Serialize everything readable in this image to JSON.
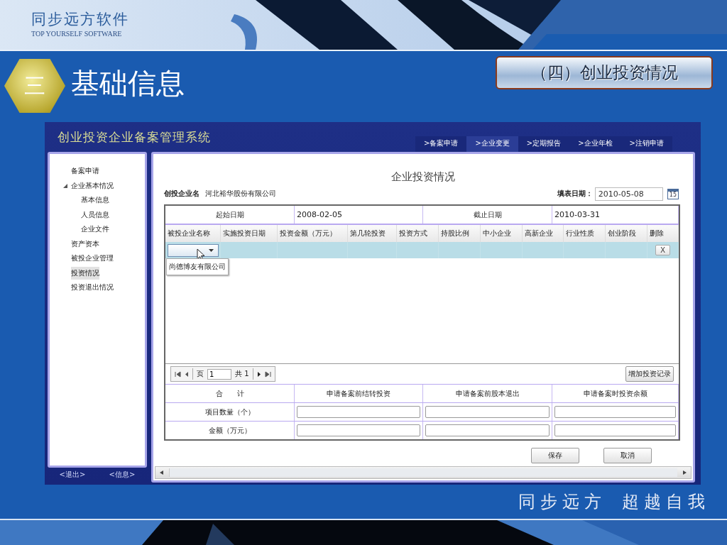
{
  "brand": {
    "name": "同步远方软件",
    "tagline": "TOP YOURSELF SOFTWARE"
  },
  "section": {
    "number": "三",
    "title": "基础信息",
    "subtitle": "（四）创业投资情况"
  },
  "app": {
    "title": "创业投资企业备案管理系统",
    "nav": [
      {
        "label": ">备案申请",
        "selected": false
      },
      {
        "label": ">企业变更",
        "selected": true
      },
      {
        "label": ">定期报告",
        "selected": false
      },
      {
        "label": ">企业年检",
        "selected": false
      },
      {
        "label": ">注销申请",
        "selected": false
      }
    ],
    "sidebar": {
      "items": [
        {
          "label": "备案申请",
          "selected": false
        },
        {
          "label": "企业基本情况",
          "selected": false,
          "expanded": true,
          "children": [
            {
              "label": "基本信息",
              "selected": false
            },
            {
              "label": "人员信息",
              "selected": false
            },
            {
              "label": "企业文件",
              "selected": false
            }
          ]
        },
        {
          "label": "资产资本",
          "selected": false
        },
        {
          "label": "被投企业管理",
          "selected": false
        },
        {
          "label": "投资情况",
          "selected": true
        },
        {
          "label": "投资退出情况",
          "selected": false
        }
      ],
      "footer": [
        "<退出>",
        "<信息>"
      ]
    },
    "form": {
      "heading": "企业投资情况",
      "company_label": "创投企业名",
      "company": "河北裕华股份有限公司",
      "date_label": "填表日期：",
      "date": "2010-05-08",
      "calendar_day": "15",
      "period": {
        "start_label": "起始日期",
        "start": "2008-02-05",
        "end_label": "截止日期",
        "end": "2010-03-31"
      },
      "columns": [
        "被投企业名称",
        "实施投资日期",
        "投资金额（万元）",
        "第几轮投资",
        "投资方式",
        "持股比例",
        "中小企业",
        "高新企业",
        "行业性质",
        "创业阶段",
        "删除"
      ],
      "rows": [
        {
          "delete": "X",
          "dropdown": {
            "open": true,
            "options": [
              "尚德博友有限公司"
            ]
          }
        }
      ],
      "pager": {
        "page_label": "页",
        "page": "1",
        "total": "共 1"
      },
      "add_button": "增加投资记录",
      "summary": {
        "columns": [
          "合　　计",
          "申请备案前结转投资",
          "申请备案前股本退出",
          "申请备案时投资余额"
        ],
        "rows": [
          "项目数量（个）",
          "金额（万元）"
        ]
      },
      "buttons": [
        "保存",
        "取消"
      ]
    }
  },
  "slogan": [
    "同步远方",
    "超越自我"
  ]
}
